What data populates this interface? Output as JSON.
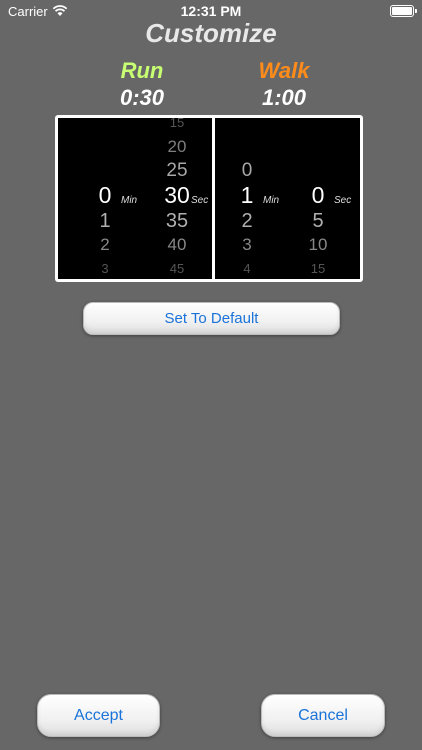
{
  "status": {
    "carrier": "Carrier",
    "time": "12:31 PM"
  },
  "title": "Customize",
  "run": {
    "label": "Run",
    "value": "0:30"
  },
  "walk": {
    "label": "Walk",
    "value": "1:00"
  },
  "picker": {
    "run_min": {
      "above": [],
      "selected": "0",
      "below": [
        "1",
        "2",
        "3"
      ],
      "unit": "Min"
    },
    "run_sec": {
      "above": [
        "15",
        "20",
        "25"
      ],
      "selected": "30",
      "below": [
        "35",
        "40",
        "45"
      ],
      "unit": "Sec"
    },
    "walk_min": {
      "above": [
        "0"
      ],
      "selected": "1",
      "below": [
        "2",
        "3",
        "4"
      ],
      "unit": "Min"
    },
    "walk_sec": {
      "above": [],
      "selected": "0",
      "below": [
        "5",
        "10",
        "15"
      ],
      "unit": "Sec"
    }
  },
  "buttons": {
    "default": "Set To Default",
    "accept": "Accept",
    "cancel": "Cancel"
  },
  "colors": {
    "background": "#676767",
    "run": "#c8ff72",
    "walk": "#ff8c1a",
    "button_text": "#1a73d9"
  }
}
